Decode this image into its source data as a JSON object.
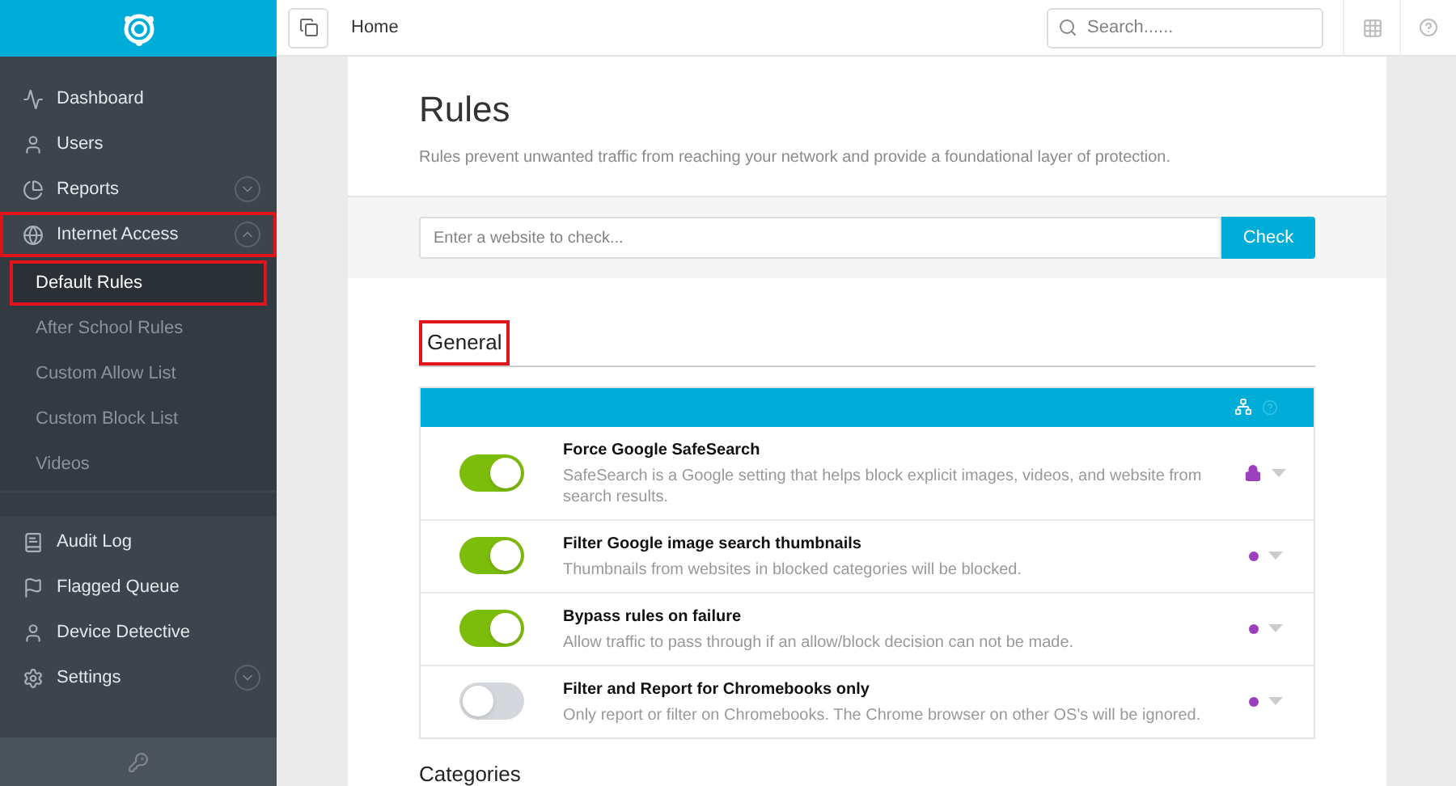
{
  "topbar": {
    "breadcrumb": "Home",
    "search": {
      "placeholder": "Search......"
    }
  },
  "sidebar": {
    "items": [
      {
        "label": "Dashboard",
        "selected": false,
        "highlighted": false
      },
      {
        "label": "Users",
        "selected": false,
        "highlighted": false
      },
      {
        "label": "Reports",
        "selected": false,
        "highlighted": false,
        "expanded": false
      },
      {
        "label": "Internet Access",
        "selected": false,
        "highlighted": true,
        "expanded": true,
        "children": [
          {
            "label": "Default Rules",
            "selected": true,
            "highlighted": true
          },
          {
            "label": "After School Rules",
            "selected": false,
            "highlighted": false
          },
          {
            "label": "Custom Allow List",
            "selected": false,
            "highlighted": false
          },
          {
            "label": "Custom Block List",
            "selected": false,
            "highlighted": false
          },
          {
            "label": "Videos",
            "selected": false,
            "highlighted": false
          }
        ]
      },
      {
        "label": "Audit Log",
        "selected": false,
        "highlighted": false
      },
      {
        "label": "Flagged Queue",
        "selected": false,
        "highlighted": false
      },
      {
        "label": "Device Detective",
        "selected": false,
        "highlighted": false
      },
      {
        "label": "Settings",
        "selected": false,
        "highlighted": false,
        "expanded": false
      }
    ]
  },
  "page": {
    "title": "Rules",
    "subtitle": "Rules prevent unwanted traffic from reaching your network and provide a foundational layer of protection.",
    "check": {
      "placeholder": "Enter a website to check...",
      "button": "Check"
    },
    "section": {
      "title": "General",
      "highlighted": true
    },
    "rules": [
      {
        "title": "Force Google SafeSearch",
        "description": "SafeSearch is a Google setting that helps block explicit images, videos, and website from search results.",
        "on": true,
        "kind": "lock"
      },
      {
        "title": "Filter Google image search thumbnails",
        "description": "Thumbnails from websites in blocked categories will be blocked.",
        "on": true,
        "kind": "dot"
      },
      {
        "title": "Bypass rules on failure",
        "description": "Allow traffic to pass through if an allow/block decision can not be made.",
        "on": true,
        "kind": "dot"
      },
      {
        "title": "Filter and Report for Chromebooks only",
        "description": "Only report or filter on Chromebooks. The Chrome browser on other OS's will be ignored.",
        "on": false,
        "kind": "dot"
      }
    ],
    "next_section": "Categories"
  }
}
